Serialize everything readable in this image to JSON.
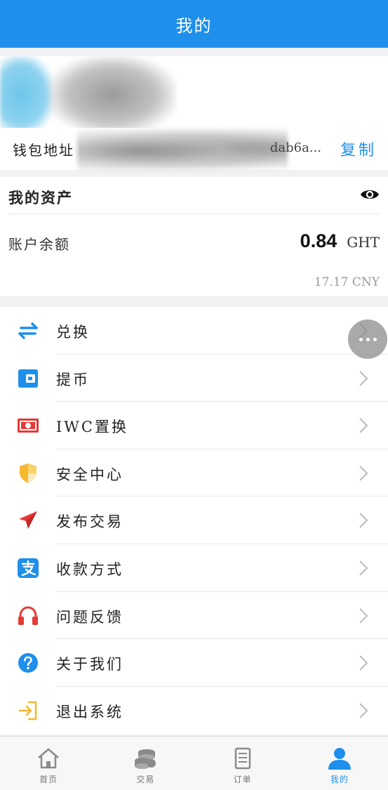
{
  "header": {
    "title": "我的"
  },
  "wallet": {
    "label": "钱包地址",
    "address_visible": "dab6a...",
    "copy_label": "复制"
  },
  "assets": {
    "title": "我的资产",
    "balance_label": "账户余额",
    "balance_value": "0.84",
    "balance_unit": "GHT",
    "balance_cny": "17.17 CNY"
  },
  "menu": {
    "items": [
      {
        "label": "兑换",
        "icon": "exchange-icon"
      },
      {
        "label": "提币",
        "icon": "wallet-icon"
      },
      {
        "label": "IWC置换",
        "icon": "banknote-icon"
      },
      {
        "label": "安全中心",
        "icon": "shield-icon"
      },
      {
        "label": "发布交易",
        "icon": "paper-plane-icon"
      },
      {
        "label": "收款方式",
        "icon": "alipay-icon"
      },
      {
        "label": "问题反馈",
        "icon": "headphones-icon"
      },
      {
        "label": "关于我们",
        "icon": "question-icon"
      },
      {
        "label": "退出系统",
        "icon": "logout-icon"
      }
    ]
  },
  "tabbar": {
    "tabs": [
      {
        "label": "首页",
        "icon": "home-icon"
      },
      {
        "label": "交易",
        "icon": "coins-icon"
      },
      {
        "label": "订单",
        "icon": "order-list-icon"
      },
      {
        "label": "我的",
        "icon": "user-icon",
        "active": true
      }
    ]
  },
  "colors": {
    "brand": "#1e8fea",
    "background": "#f2f2f4",
    "secondary_text": "#999999"
  }
}
